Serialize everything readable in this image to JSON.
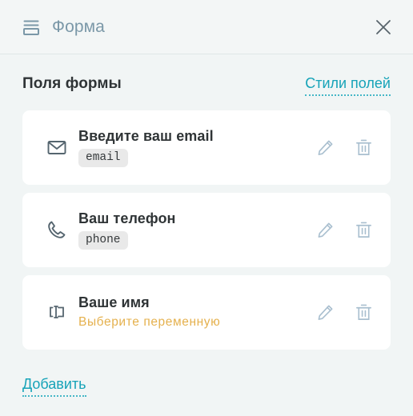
{
  "header": {
    "title": "Форма",
    "icon": "form-icon",
    "close_icon": "close-icon"
  },
  "section": {
    "title": "Поля формы",
    "styles_link": "Стили полей"
  },
  "fields": [
    {
      "icon": "envelope-icon",
      "title": "Введите ваш email",
      "badge": "email",
      "warning": null,
      "edit_icon": "pencil-icon",
      "delete_icon": "trash-icon"
    },
    {
      "icon": "phone-icon",
      "title": "Ваш телефон",
      "badge": "phone",
      "warning": null,
      "edit_icon": "pencil-icon",
      "delete_icon": "trash-icon"
    },
    {
      "icon": "text-input-icon",
      "title": "Ваше имя",
      "badge": null,
      "warning": "Выберите  переменную",
      "edit_icon": "pencil-icon",
      "delete_icon": "trash-icon"
    }
  ],
  "footer": {
    "add_label": "Добавить"
  },
  "colors": {
    "page_background": "#f1f5f5",
    "card_background": "#ffffff",
    "accent_teal": "#16a3b8",
    "header_title": "#7b98a8",
    "warning_amber": "#e5b14e",
    "action_icon": "#a9bfcf",
    "badge_background": "#e9e9e9",
    "text_primary": "#2f3436"
  }
}
